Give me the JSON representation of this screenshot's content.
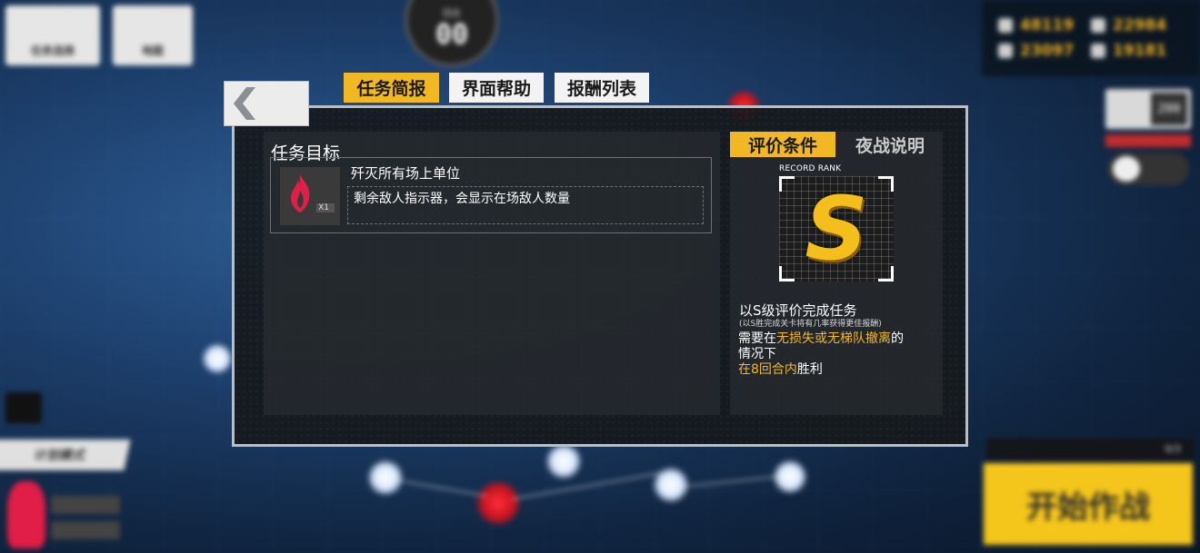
{
  "header": {
    "back_label": "任务选择",
    "second_btn_label": "地图",
    "turn_label": "回合",
    "turn_value": "00"
  },
  "resources": [
    "48119",
    "22984",
    "23097",
    "19181"
  ],
  "right_panel": {
    "value": "200"
  },
  "left_panel": {
    "mode_label": "计划模式"
  },
  "start": {
    "caption": "0/3",
    "label": "开始作战"
  },
  "tabs": [
    {
      "label": "任务简报",
      "active": true
    },
    {
      "label": "界面帮助",
      "active": false
    },
    {
      "label": "报酬列表",
      "active": false
    }
  ],
  "objective": {
    "section_title": "任务目标",
    "name": "歼灭所有场上单位",
    "icon_count": "X1",
    "description": "剩余敌人指示器，会显示在场敌人数量"
  },
  "subtabs": [
    {
      "label": "评价条件",
      "active": true
    },
    {
      "label": "夜战说明",
      "active": false
    }
  ],
  "rank": {
    "record_label": "RECORD RANK",
    "letter": "S",
    "title": "以S级评价完成任务",
    "note": "(以S胜完成关卡将有几率获得更佳报酬)",
    "cond1_prefix": "需要在",
    "cond1_highlight": "无损失或无梯队撤离",
    "cond1_suffix": "的",
    "cond2": "情况下",
    "cond3_highlight": "在8回合内",
    "cond3_suffix": "胜利"
  },
  "colors": {
    "accent": "#f2b823",
    "enemy": "#e01e48",
    "panel": "#16191c"
  },
  "icons": [
    "chevron-left-icon",
    "flame-icon",
    "eye-icon"
  ]
}
